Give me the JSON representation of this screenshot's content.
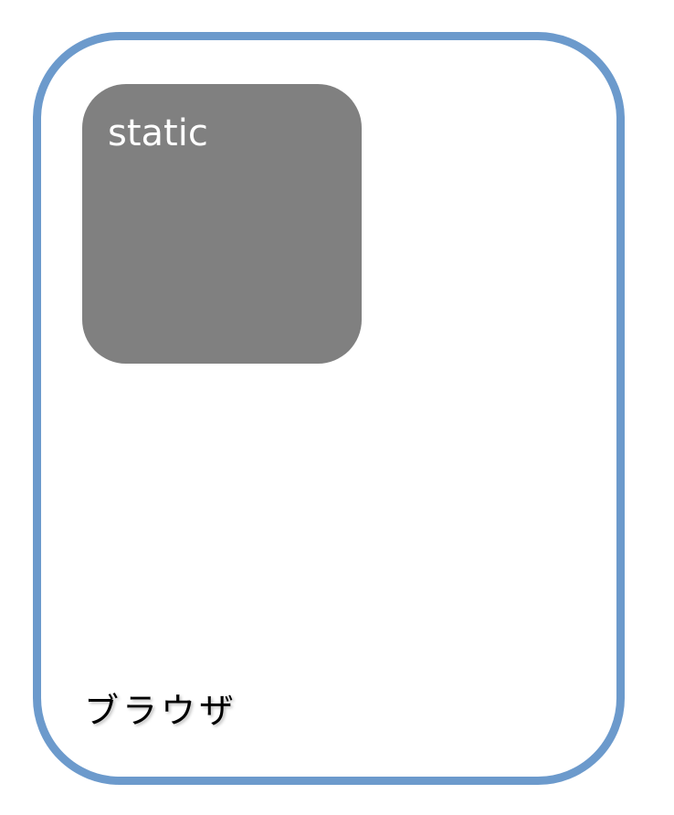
{
  "diagram": {
    "browser": {
      "label": "ブラウザ",
      "border_color": "#6c9acc"
    },
    "element": {
      "label": "static",
      "fill_color": "#808080",
      "text_color": "#ffffff"
    }
  }
}
